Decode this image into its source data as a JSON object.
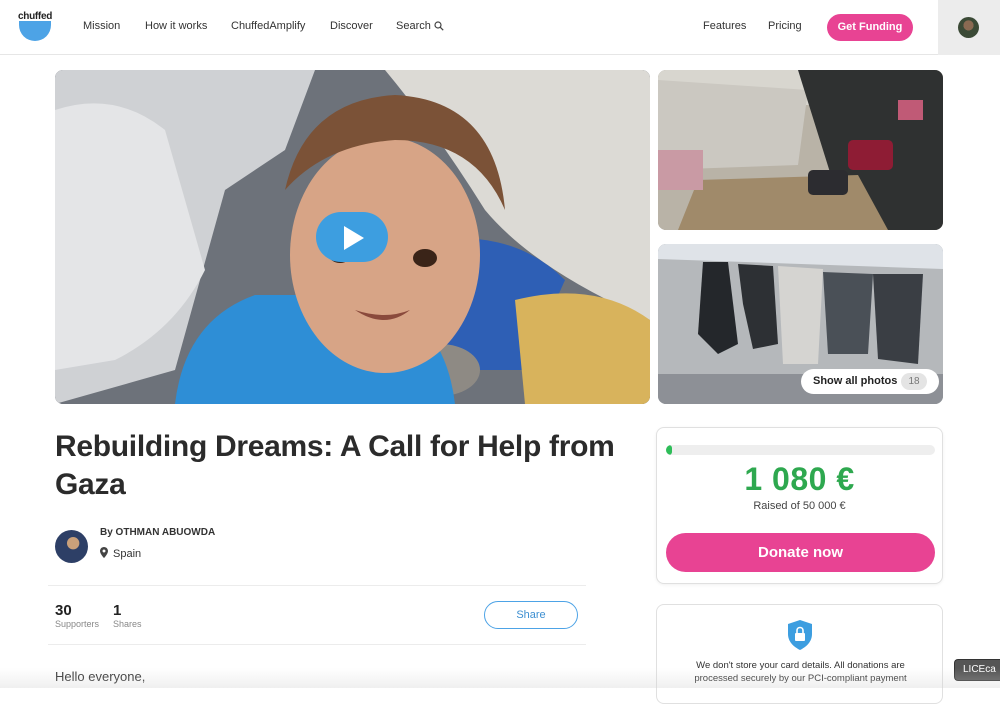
{
  "header": {
    "logo_text": "chuffed",
    "nav": {
      "mission": "Mission",
      "how_it_works": "How it works",
      "amplify": "ChuffedAmplify",
      "discover": "Discover",
      "search": "Search"
    },
    "features": "Features",
    "pricing": "Pricing",
    "get_funding": "Get Funding"
  },
  "gallery": {
    "show_all_label": "Show all photos",
    "photo_count": "18"
  },
  "campaign": {
    "title": "Rebuilding Dreams: A Call for Help from Gaza",
    "author_by": "By OTHMAN ABUOWDA",
    "location": "Spain",
    "supporters_count": "30",
    "supporters_label": "Supporters",
    "shares_count": "1",
    "shares_label": "Shares",
    "share_button": "Share",
    "story_start": "Hello everyone,"
  },
  "funding": {
    "raised": "1 080 €",
    "raised_of": "Raised of 50 000 €",
    "progress_fraction": 0.0216,
    "donate_button": "Donate now"
  },
  "security": {
    "text": "We don't store your card details. All donations are processed securely by our PCI-compliant payment"
  },
  "tooltip": "LICEca",
  "colors": {
    "brand_pink": "#e84393",
    "brand_blue": "#4da3e6",
    "money_green": "#2ea84f"
  }
}
